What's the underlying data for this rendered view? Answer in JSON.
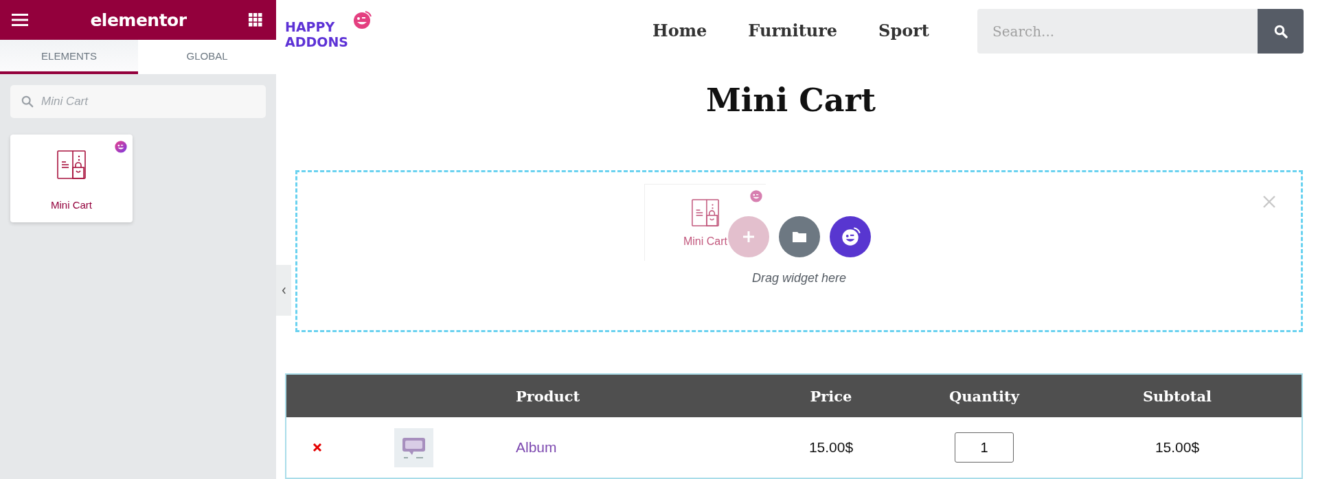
{
  "sidebar": {
    "brand": "elementor",
    "tabs": [
      {
        "label": "ELEMENTS",
        "selected": true
      },
      {
        "label": "GLOBAL",
        "selected": false
      }
    ],
    "search": {
      "value": "Mini Cart"
    },
    "widgets": [
      {
        "label": "Mini Cart"
      }
    ]
  },
  "header": {
    "logo": [
      "HAPPY",
      "ADDONS"
    ],
    "nav": [
      "Home",
      "Furniture",
      "Sport"
    ],
    "search": {
      "placeholder": "Search..."
    }
  },
  "page_title": "Mini Cart",
  "dropzone": {
    "dragged_widget": {
      "label": "Mini Cart"
    },
    "hint": "Drag widget here"
  },
  "cart": {
    "columns": [
      "Product",
      "Price",
      "Quantity",
      "Subtotal"
    ],
    "rows": [
      {
        "product": "Album",
        "price": "15.00$",
        "quantity": "1",
        "subtotal": "15.00$"
      }
    ]
  }
}
